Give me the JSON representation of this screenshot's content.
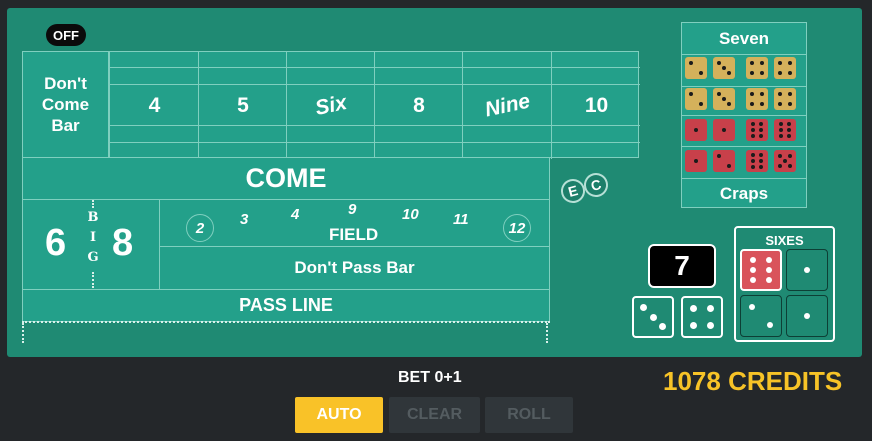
{
  "table": {
    "off_puck": "OFF",
    "dont_come_bar": "Don't\nCome\nBar",
    "place_numbers": [
      "4",
      "5",
      "Six",
      "8",
      "Nine",
      "10"
    ],
    "come": "COME",
    "big_six": "6",
    "big_eight": "8",
    "big_label": [
      "B",
      "I",
      "G"
    ],
    "field_numbers": [
      "2",
      "3",
      "4",
      "9",
      "10",
      "11",
      "12"
    ],
    "field_label": "FIELD",
    "dont_pass_bar": "Don't Pass Bar",
    "pass_line": "PASS LINE",
    "e_bet": "E",
    "c_bet": "C"
  },
  "proposition": {
    "top_label": "Seven",
    "bottom_label": "Craps",
    "colors": {
      "seven": "#d4b15b",
      "craps": "#c8404a"
    }
  },
  "point": "7",
  "dice": [
    3,
    4
  ],
  "sixes": {
    "title": "SIXES",
    "dice": [
      6,
      1,
      2,
      1
    ],
    "colors": {
      "active": "#d9535b",
      "normal": "#1f8a73"
    }
  },
  "footer": {
    "bet": "BET 0+1",
    "credits": "1078 CREDITS",
    "buttons": {
      "auto": "AUTO",
      "clear": "CLEAR",
      "roll": "ROLL"
    }
  },
  "colors": {
    "felt": "#1f8a73",
    "accent": "#f7c327"
  }
}
